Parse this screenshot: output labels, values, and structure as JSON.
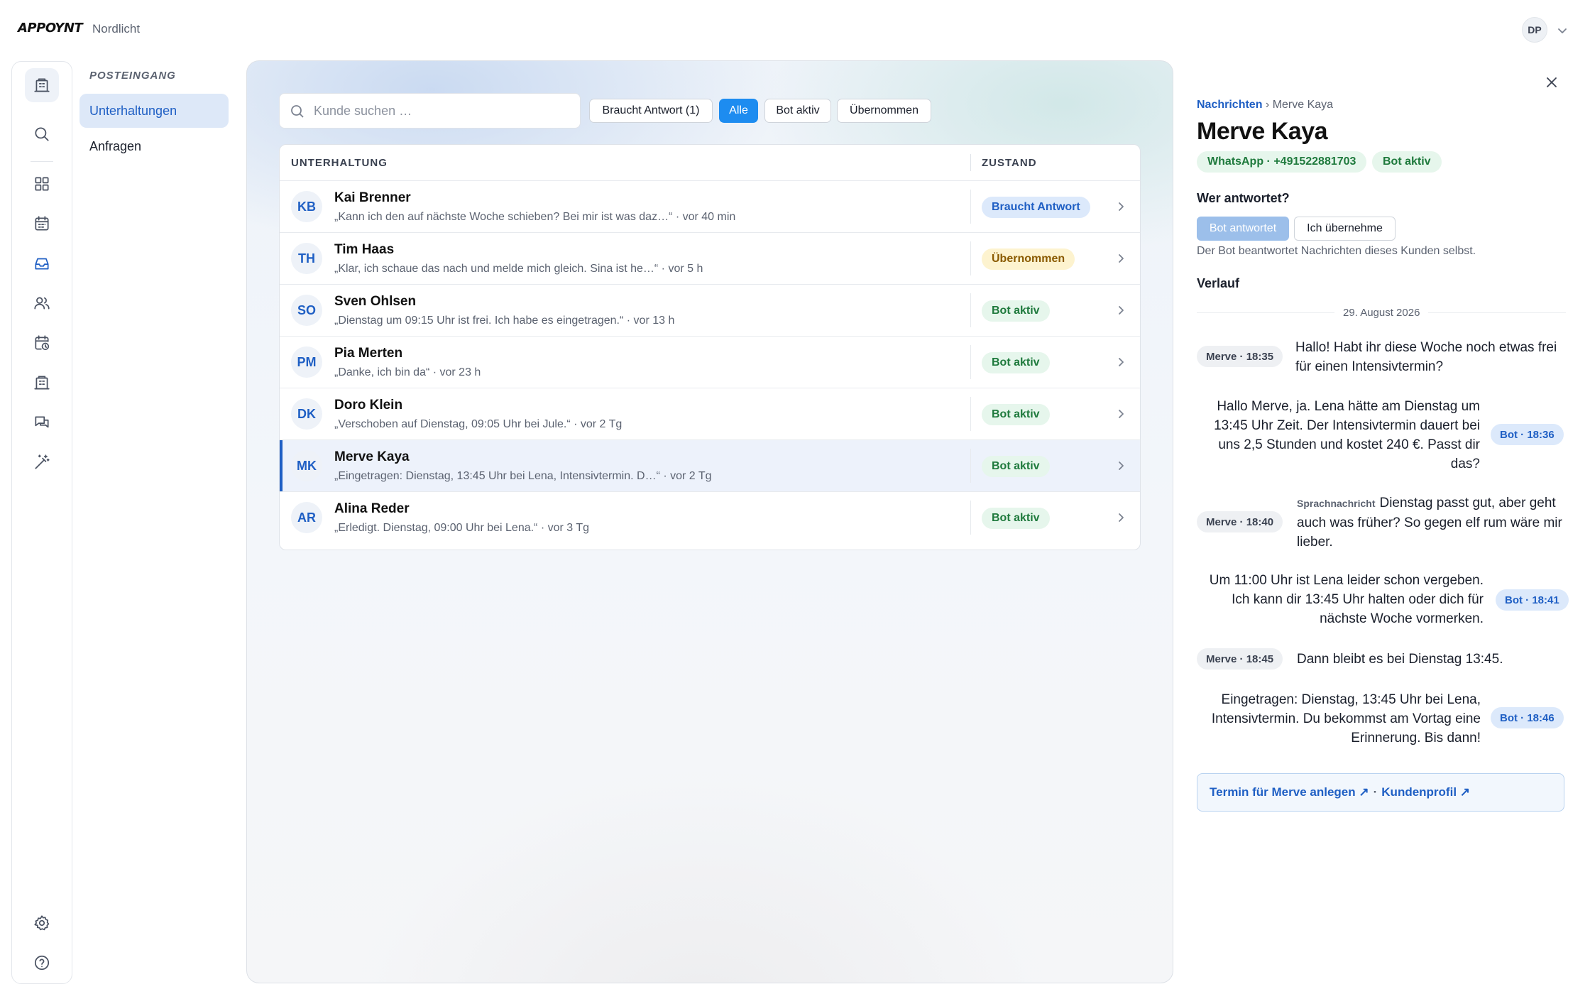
{
  "app": {
    "logo": "APPOYNT",
    "workspace": "Nordlicht",
    "user_initials": "DP"
  },
  "rail": [
    {
      "name": "building-icon",
      "active": true
    },
    {
      "name": "search-icon"
    },
    {
      "name": "grid-icon"
    },
    {
      "name": "calendar-icon"
    },
    {
      "name": "inbox-icon",
      "blue": true
    },
    {
      "name": "users-icon"
    },
    {
      "name": "calendar-clock-icon"
    },
    {
      "name": "building-icon"
    },
    {
      "name": "chat-icon"
    },
    {
      "name": "magic-wand-icon"
    },
    {
      "name": "gear-icon"
    },
    {
      "name": "help-icon"
    }
  ],
  "subnav": {
    "title": "POSTEINGANG",
    "items": [
      {
        "label": "Unterhaltungen",
        "active": true
      },
      {
        "label": "Anfragen"
      }
    ]
  },
  "search": {
    "placeholder": "Kunde suchen …",
    "value": ""
  },
  "filters": [
    {
      "label": "Braucht Antwort (1)"
    },
    {
      "label": "Alle",
      "active": true
    },
    {
      "label": "Bot aktiv"
    },
    {
      "label": "Übernommen"
    }
  ],
  "table": {
    "columns": [
      "UNTERHALTUNG",
      "ZUSTAND"
    ],
    "rows": [
      {
        "initials": "KB",
        "name": "Kai Brenner",
        "preview": "„Kann ich den auf nächste Woche schieben? Bei mir ist was daz…“ · vor 40 min",
        "status": "Braucht Antwort",
        "status_color": "blue"
      },
      {
        "initials": "TH",
        "name": "Tim Haas",
        "preview": "„Klar, ich schaue das nach und melde mich gleich. Sina ist he…“ · vor 5 h",
        "status": "Übernommen",
        "status_color": "yellow"
      },
      {
        "initials": "SO",
        "name": "Sven Ohlsen",
        "preview": "„Dienstag um 09:15 Uhr ist frei. Ich habe es eingetragen.“ · vor 13 h",
        "status": "Bot aktiv",
        "status_color": "green"
      },
      {
        "initials": "PM",
        "name": "Pia Merten",
        "preview": "„Danke, ich bin da“ · vor 23 h",
        "status": "Bot aktiv",
        "status_color": "green"
      },
      {
        "initials": "DK",
        "name": "Doro Klein",
        "preview": "„Verschoben auf Dienstag, 09:05 Uhr bei Jule.“ · vor 2 Tg",
        "status": "Bot aktiv",
        "status_color": "green"
      },
      {
        "initials": "MK",
        "name": "Merve Kaya",
        "preview": "„Eingetragen: Dienstag, 13:45 Uhr bei Lena, Intensivtermin. D…“ · vor 2 Tg",
        "status": "Bot aktiv",
        "status_color": "green",
        "selected": true
      },
      {
        "initials": "AR",
        "name": "Alina Reder",
        "preview": "„Erledigt. Dienstag, 09:00 Uhr bei Lena.“ · vor 3 Tg",
        "status": "Bot aktiv",
        "status_color": "green"
      }
    ]
  },
  "detail": {
    "breadcrumb_link": "Nachrichten",
    "breadcrumb_sep": "›",
    "breadcrumb_current": "Merve Kaya",
    "name": "Merve Kaya",
    "channel_pill": "WhatsApp · +491522881703",
    "status_pill": "Bot aktiv",
    "who_label": "Wer antwortet?",
    "toggle_bot": "Bot antwortet",
    "toggle_me": "Ich übernehme",
    "toggle_hint": "Der Bot beantwortet Nachrichten dieses Kunden selbst.",
    "history_label": "Verlauf",
    "date": "29. August 2026",
    "messages": [
      {
        "from": "in",
        "tag": "Merve · 18:35",
        "text": "Hallo! Habt ihr diese Woche noch etwas frei für einen Intensivtermin?"
      },
      {
        "from": "out",
        "tag": "Bot · 18:36",
        "text": "Hallo Merve, ja. Lena hätte am Dienstag um 13:45 Uhr Zeit. Der Intensivtermin dauert bei uns 2,5 Stunden und kostet 240 €. Passt dir das?"
      },
      {
        "from": "in",
        "tag": "Merve · 18:40",
        "voice_label": "Sprachnachricht",
        "text": "Dienstag passt gut, aber geht auch was früher? So gegen elf rum wäre mir lieber."
      },
      {
        "from": "out",
        "tag": "Bot · 18:41",
        "text": "Um 11:00 Uhr ist Lena leider schon vergeben. Ich kann dir 13:45 Uhr halten oder dich für nächste Woche vormerken."
      },
      {
        "from": "in",
        "tag": "Merve · 18:45",
        "text": "Dann bleibt es bei Dienstag 13:45."
      },
      {
        "from": "out",
        "tag": "Bot · 18:46",
        "text": "Eingetragen: Dienstag, 13:45 Uhr bei Lena, Intensivtermin. Du bekommst am Vortag eine Erinnerung. Bis dann!"
      }
    ],
    "link_create": "Termin für Merve anlegen ↗",
    "link_sep": "·",
    "link_profile": "Kundenprofil ↗"
  }
}
